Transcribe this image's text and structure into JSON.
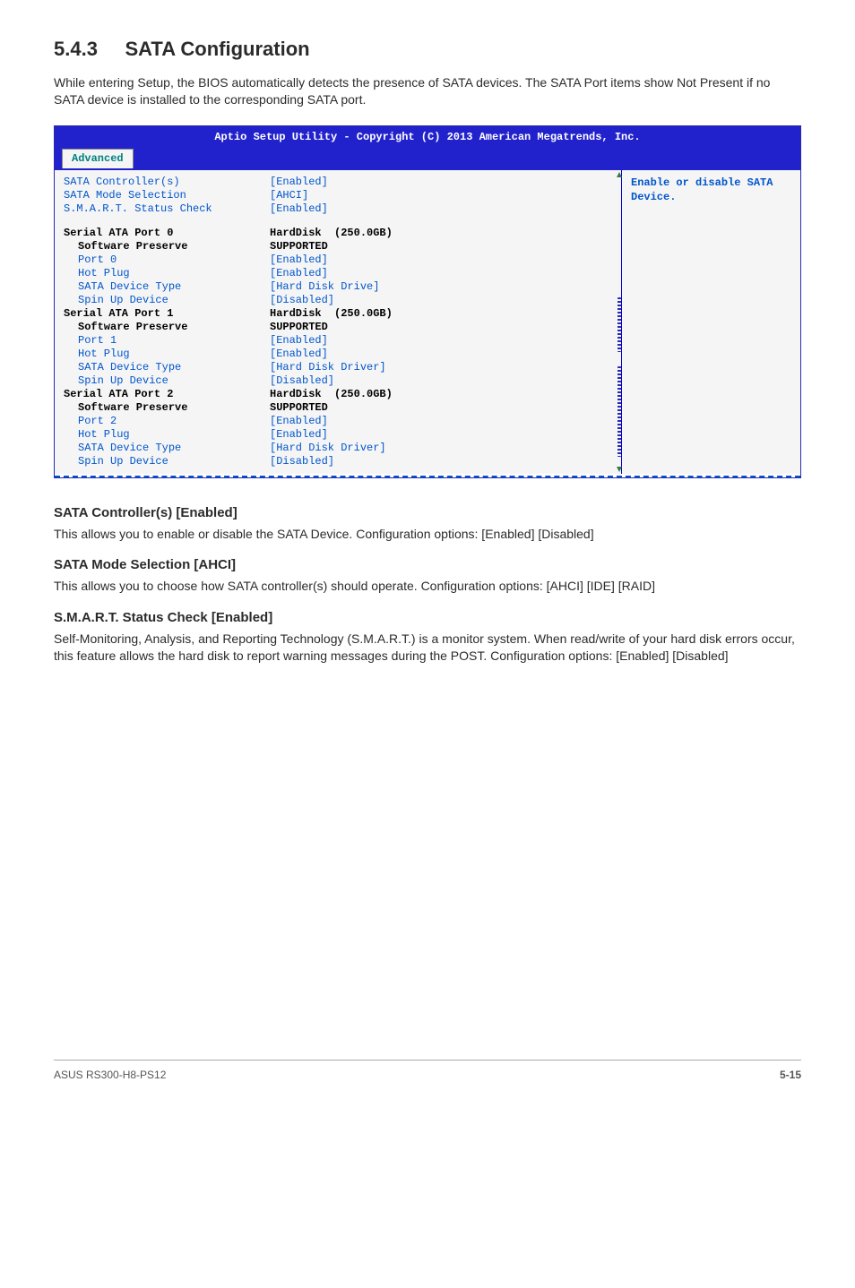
{
  "h1_num": "5.4.3",
  "h1_title": "SATA Configuration",
  "intro": "While entering Setup, the BIOS automatically detects the presence of SATA devices. The SATA Port items show Not Present if no SATA device is installed to the corresponding SATA port.",
  "bios_header": "Aptio Setup Utility - Copyright (C) 2013 American Megatrends, Inc.",
  "tab": "Advanced",
  "help_text": "Enable or disable SATA Device.",
  "top_rows": [
    {
      "l": "SATA Controller(s)",
      "v": "[Enabled]",
      "cls": "blue"
    },
    {
      "l": "SATA Mode Selection",
      "v": "[AHCI]",
      "cls": "blue"
    },
    {
      "l": "S.M.A.R.T. Status Check",
      "v": "[Enabled]",
      "cls": "blue"
    }
  ],
  "ports": [
    {
      "title": "Serial ATA Port 0",
      "title_v": "HardDisk  (250.0GB)",
      "pres_l": "Software Preserve",
      "pres_v": "SUPPORTED",
      "rows": [
        {
          "l": "Port 0",
          "v": "[Enabled]"
        },
        {
          "l": "Hot Plug",
          "v": "[Enabled]"
        },
        {
          "l": "SATA Device Type",
          "v": "[Hard Disk Drive]"
        },
        {
          "l": "Spin Up Device",
          "v": "[Disabled]"
        }
      ]
    },
    {
      "title": "Serial ATA Port 1",
      "title_v": "HardDisk  (250.0GB)",
      "pres_l": "Software Preserve",
      "pres_v": "SUPPORTED",
      "rows": [
        {
          "l": "Port 1",
          "v": "[Enabled]"
        },
        {
          "l": "Hot Plug",
          "v": "[Enabled]"
        },
        {
          "l": "SATA Device Type",
          "v": "[Hard Disk Driver]"
        },
        {
          "l": "Spin Up Device",
          "v": "[Disabled]"
        }
      ]
    },
    {
      "title": "Serial ATA Port 2",
      "title_v": "HardDisk  (250.0GB)",
      "pres_l": "Software Preserve",
      "pres_v": "SUPPORTED",
      "rows": [
        {
          "l": "Port 2",
          "v": "[Enabled]"
        },
        {
          "l": "Hot Plug",
          "v": "[Enabled]"
        },
        {
          "l": "SATA Device Type",
          "v": "[Hard Disk Driver]"
        },
        {
          "l": "Spin Up Device",
          "v": "[Disabled]"
        }
      ]
    }
  ],
  "sections": [
    {
      "h": "SATA Controller(s) [Enabled]",
      "p": "This allows you to enable or disable the SATA Device. Configuration options: [Enabled] [Disabled]"
    },
    {
      "h": "SATA Mode Selection [AHCI]",
      "p": "This allows you to choose how SATA controller(s) should operate. Configuration options: [AHCI] [IDE] [RAID]"
    },
    {
      "h": "S.M.A.R.T. Status Check [Enabled]",
      "p": "Self-Monitoring, Analysis, and Reporting Technology (S.M.A.R.T.) is a monitor system. When read/write of your hard disk errors occur, this feature allows the hard disk to report warning messages during the POST. Configuration options: [Enabled] [Disabled]"
    }
  ],
  "footer_left": "ASUS RS300-H8-PS12",
  "footer_right": "5-15"
}
